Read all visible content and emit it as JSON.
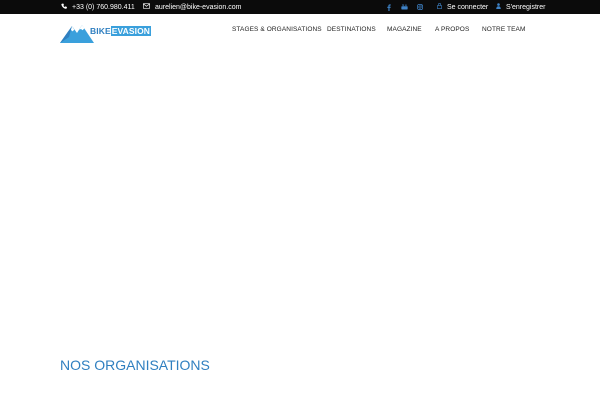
{
  "topbar": {
    "phone": "+33 (0) 760.980.411",
    "email": "aurelien@bike-evasion.com",
    "social_icons": [
      "facebook-icon",
      "youtube-icon",
      "instagram-icon"
    ],
    "login": "Se connecter",
    "register": "S'enregistrer"
  },
  "logo": {
    "bike": "BIKE",
    "evasion": "EVASION"
  },
  "nav": {
    "items": [
      "STAGES & ORGANISATIONS",
      "DESTINATIONS",
      "MAGAZINE",
      "A PROPOS",
      "NOTRE TEAM"
    ]
  },
  "main": {
    "section_title": "NOS ORGANISATIONS"
  },
  "colors": {
    "topbar_bg": "#0b0b0b",
    "accent": "#2f7fc0",
    "logo_light": "#3aa0dc"
  }
}
